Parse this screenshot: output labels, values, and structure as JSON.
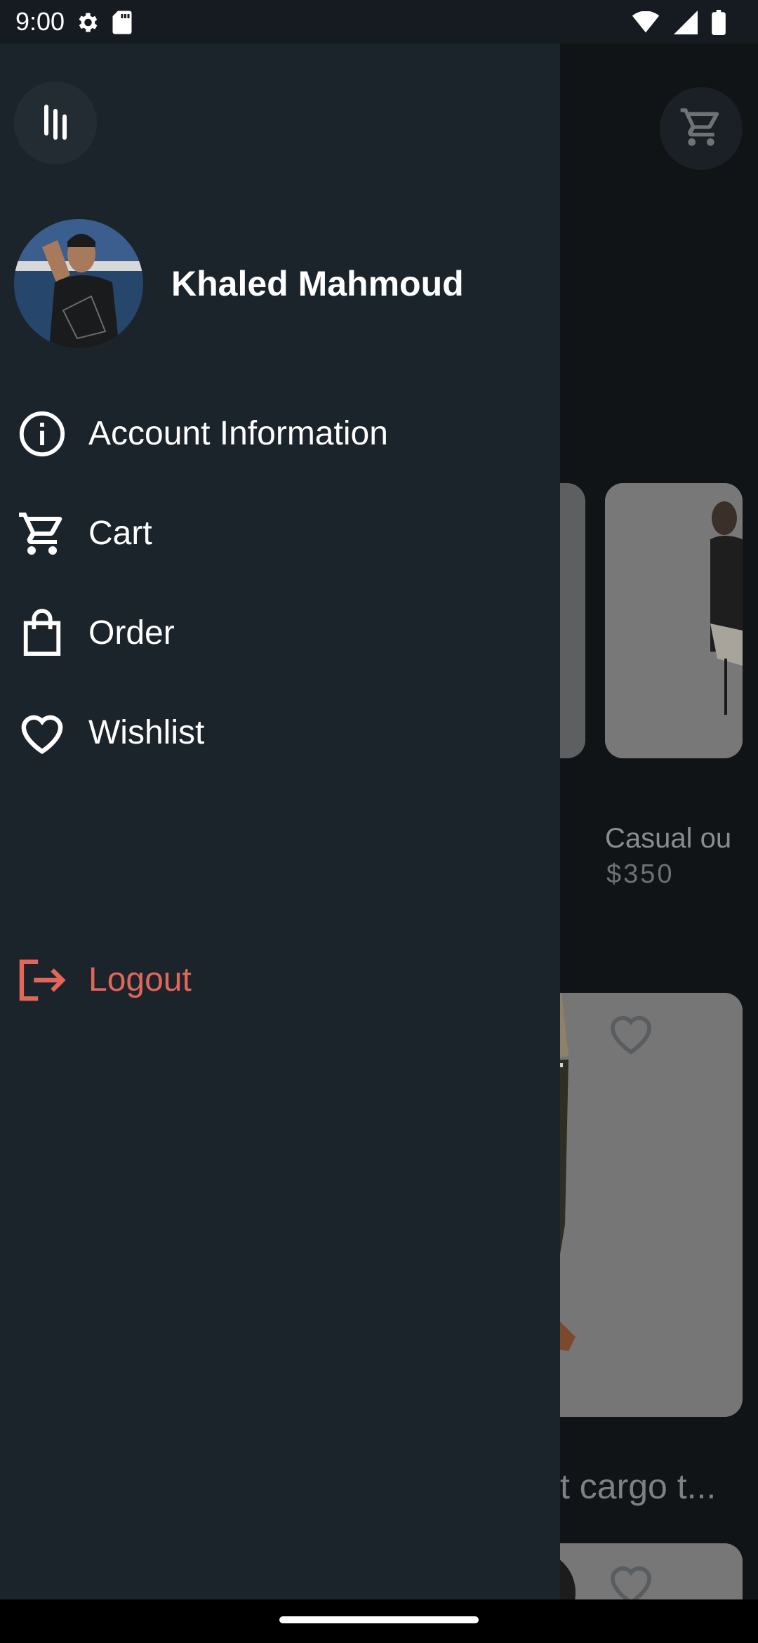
{
  "status_bar": {
    "time": "9:00",
    "icons": [
      "settings-icon",
      "sd-card-icon",
      "wifi-icon",
      "signal-icon",
      "battery-icon"
    ]
  },
  "background": {
    "products": [
      {
        "title": "Casual ou",
        "price": "$350"
      },
      {
        "title": "t cargo t..."
      }
    ],
    "icons": [
      "cart-icon",
      "heart-icon"
    ]
  },
  "drawer": {
    "user_name": "Khaled Mahmoud",
    "menu": [
      {
        "label": "Account Information",
        "icon": "info-icon"
      },
      {
        "label": "Cart",
        "icon": "cart-icon"
      },
      {
        "label": "Order",
        "icon": "shopping-bag-icon"
      },
      {
        "label": "Wishlist",
        "icon": "heart-icon"
      }
    ],
    "logout": {
      "label": "Logout",
      "icon": "logout-icon",
      "color": "#e3665a"
    }
  },
  "colors": {
    "drawer_bg": "#1c242b",
    "accent_logout": "#e3665a",
    "text": "#ffffff"
  }
}
